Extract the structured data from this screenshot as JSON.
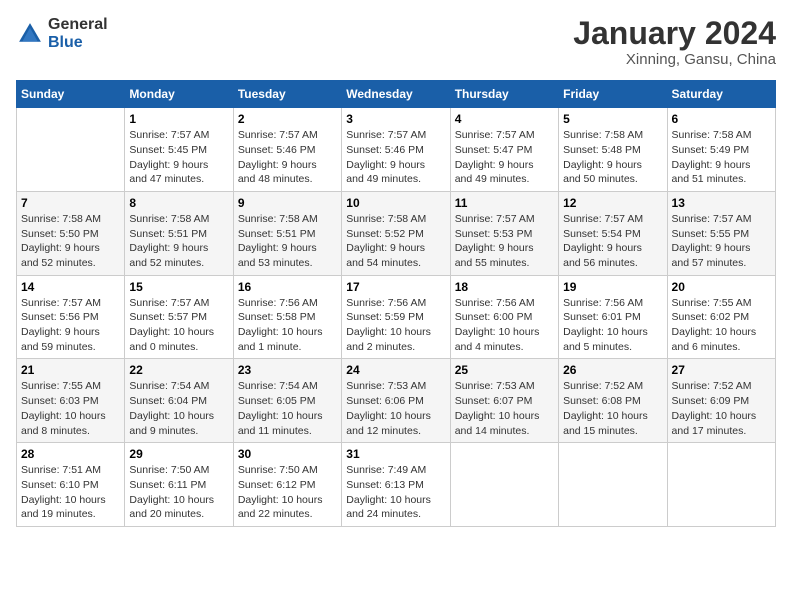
{
  "header": {
    "logo": {
      "general": "General",
      "blue": "Blue"
    },
    "title": "January 2024",
    "location": "Xinning, Gansu, China"
  },
  "calendar": {
    "days_of_week": [
      "Sunday",
      "Monday",
      "Tuesday",
      "Wednesday",
      "Thursday",
      "Friday",
      "Saturday"
    ],
    "weeks": [
      [
        {
          "day": null,
          "info": null
        },
        {
          "day": "1",
          "info": "Sunrise: 7:57 AM\nSunset: 5:45 PM\nDaylight: 9 hours\nand 47 minutes."
        },
        {
          "day": "2",
          "info": "Sunrise: 7:57 AM\nSunset: 5:46 PM\nDaylight: 9 hours\nand 48 minutes."
        },
        {
          "day": "3",
          "info": "Sunrise: 7:57 AM\nSunset: 5:46 PM\nDaylight: 9 hours\nand 49 minutes."
        },
        {
          "day": "4",
          "info": "Sunrise: 7:57 AM\nSunset: 5:47 PM\nDaylight: 9 hours\nand 49 minutes."
        },
        {
          "day": "5",
          "info": "Sunrise: 7:58 AM\nSunset: 5:48 PM\nDaylight: 9 hours\nand 50 minutes."
        },
        {
          "day": "6",
          "info": "Sunrise: 7:58 AM\nSunset: 5:49 PM\nDaylight: 9 hours\nand 51 minutes."
        }
      ],
      [
        {
          "day": "7",
          "info": "Sunrise: 7:58 AM\nSunset: 5:50 PM\nDaylight: 9 hours\nand 52 minutes."
        },
        {
          "day": "8",
          "info": "Sunrise: 7:58 AM\nSunset: 5:51 PM\nDaylight: 9 hours\nand 52 minutes."
        },
        {
          "day": "9",
          "info": "Sunrise: 7:58 AM\nSunset: 5:51 PM\nDaylight: 9 hours\nand 53 minutes."
        },
        {
          "day": "10",
          "info": "Sunrise: 7:58 AM\nSunset: 5:52 PM\nDaylight: 9 hours\nand 54 minutes."
        },
        {
          "day": "11",
          "info": "Sunrise: 7:57 AM\nSunset: 5:53 PM\nDaylight: 9 hours\nand 55 minutes."
        },
        {
          "day": "12",
          "info": "Sunrise: 7:57 AM\nSunset: 5:54 PM\nDaylight: 9 hours\nand 56 minutes."
        },
        {
          "day": "13",
          "info": "Sunrise: 7:57 AM\nSunset: 5:55 PM\nDaylight: 9 hours\nand 57 minutes."
        }
      ],
      [
        {
          "day": "14",
          "info": "Sunrise: 7:57 AM\nSunset: 5:56 PM\nDaylight: 9 hours\nand 59 minutes."
        },
        {
          "day": "15",
          "info": "Sunrise: 7:57 AM\nSunset: 5:57 PM\nDaylight: 10 hours\nand 0 minutes."
        },
        {
          "day": "16",
          "info": "Sunrise: 7:56 AM\nSunset: 5:58 PM\nDaylight: 10 hours\nand 1 minute."
        },
        {
          "day": "17",
          "info": "Sunrise: 7:56 AM\nSunset: 5:59 PM\nDaylight: 10 hours\nand 2 minutes."
        },
        {
          "day": "18",
          "info": "Sunrise: 7:56 AM\nSunset: 6:00 PM\nDaylight: 10 hours\nand 4 minutes."
        },
        {
          "day": "19",
          "info": "Sunrise: 7:56 AM\nSunset: 6:01 PM\nDaylight: 10 hours\nand 5 minutes."
        },
        {
          "day": "20",
          "info": "Sunrise: 7:55 AM\nSunset: 6:02 PM\nDaylight: 10 hours\nand 6 minutes."
        }
      ],
      [
        {
          "day": "21",
          "info": "Sunrise: 7:55 AM\nSunset: 6:03 PM\nDaylight: 10 hours\nand 8 minutes."
        },
        {
          "day": "22",
          "info": "Sunrise: 7:54 AM\nSunset: 6:04 PM\nDaylight: 10 hours\nand 9 minutes."
        },
        {
          "day": "23",
          "info": "Sunrise: 7:54 AM\nSunset: 6:05 PM\nDaylight: 10 hours\nand 11 minutes."
        },
        {
          "day": "24",
          "info": "Sunrise: 7:53 AM\nSunset: 6:06 PM\nDaylight: 10 hours\nand 12 minutes."
        },
        {
          "day": "25",
          "info": "Sunrise: 7:53 AM\nSunset: 6:07 PM\nDaylight: 10 hours\nand 14 minutes."
        },
        {
          "day": "26",
          "info": "Sunrise: 7:52 AM\nSunset: 6:08 PM\nDaylight: 10 hours\nand 15 minutes."
        },
        {
          "day": "27",
          "info": "Sunrise: 7:52 AM\nSunset: 6:09 PM\nDaylight: 10 hours\nand 17 minutes."
        }
      ],
      [
        {
          "day": "28",
          "info": "Sunrise: 7:51 AM\nSunset: 6:10 PM\nDaylight: 10 hours\nand 19 minutes."
        },
        {
          "day": "29",
          "info": "Sunrise: 7:50 AM\nSunset: 6:11 PM\nDaylight: 10 hours\nand 20 minutes."
        },
        {
          "day": "30",
          "info": "Sunrise: 7:50 AM\nSunset: 6:12 PM\nDaylight: 10 hours\nand 22 minutes."
        },
        {
          "day": "31",
          "info": "Sunrise: 7:49 AM\nSunset: 6:13 PM\nDaylight: 10 hours\nand 24 minutes."
        },
        {
          "day": null,
          "info": null
        },
        {
          "day": null,
          "info": null
        },
        {
          "day": null,
          "info": null
        }
      ]
    ]
  }
}
